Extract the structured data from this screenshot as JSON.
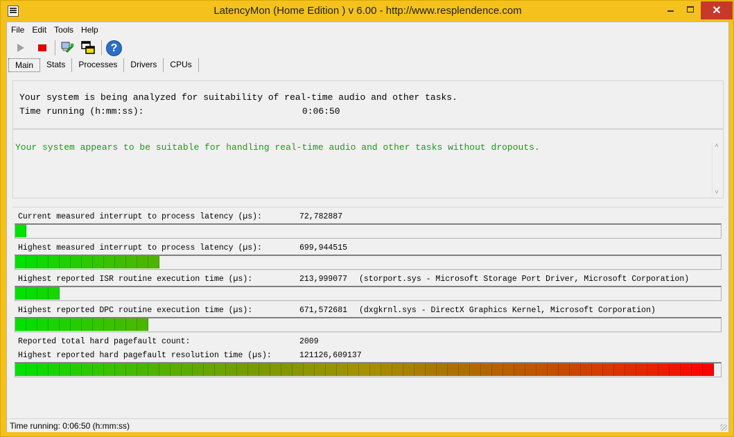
{
  "window": {
    "title": "LatencyMon  (Home Edition )  v 6.00 - http://www.resplendence.com"
  },
  "menu": [
    {
      "label": "File"
    },
    {
      "label": "Edit"
    },
    {
      "label": "Tools"
    },
    {
      "label": "Help"
    }
  ],
  "toolbar": {
    "icons": [
      "play-icon",
      "stop-icon",
      "analyze-icon",
      "windows-icon",
      "help-icon"
    ]
  },
  "tabs": [
    {
      "label": "Main",
      "active": true
    },
    {
      "label": "Stats"
    },
    {
      "label": "Processes"
    },
    {
      "label": "Drivers"
    },
    {
      "label": "CPUs"
    }
  ],
  "summary": {
    "analyzing_text": "Your system is being analyzed for suitability of real-time audio and other tasks.",
    "time_running_label": "Time running (h:mm:ss):",
    "time_running_value": "0:06:50"
  },
  "verdict": {
    "text": "Your system appears to be suitable for handling real-time audio and other tasks without dropouts.",
    "color": "#1a9a1a"
  },
  "metrics": {
    "current_latency": {
      "label": "Current measured interrupt to process latency (µs):",
      "value": "72,782887",
      "bar_level": 0.014
    },
    "highest_latency": {
      "label": "Highest measured interrupt to process latency (µs):",
      "value": "699,944515",
      "bar_level": 0.2
    },
    "highest_isr": {
      "label": "Highest reported ISR routine execution time (µs):",
      "value": "213,999077",
      "detail": "(storport.sys - Microsoft Storage Port Driver, Microsoft Corporation)",
      "bar_level": 0.06
    },
    "highest_dpc": {
      "label": "Highest reported DPC routine execution time (µs):",
      "value": "671,572681",
      "detail": "(dxgkrnl.sys - DirectX Graphics Kernel, Microsoft Corporation)",
      "bar_level": 0.185
    },
    "pagefault_count": {
      "label": "Reported total hard pagefault count:",
      "value": "2009"
    },
    "pagefault_time": {
      "label": "Highest reported hard pagefault resolution time (µs):",
      "value": "121126,609137",
      "bar_level": 1.0
    }
  },
  "status_bar": {
    "text": "Time running: 0:06:50  (h:mm:ss)"
  }
}
